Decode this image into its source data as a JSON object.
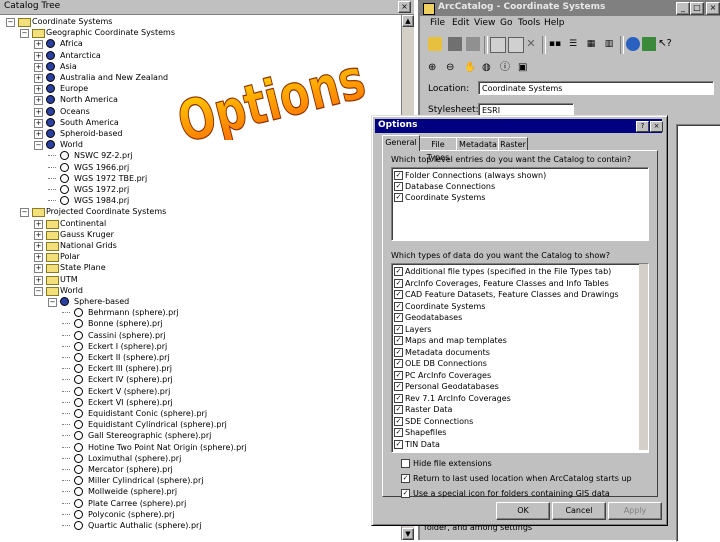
{
  "tree": {
    "title": "Catalog Tree",
    "close": "×",
    "rows": [
      {
        "label": "Coordinate Systems",
        "indent": 0,
        "exp": "−",
        "icon": "folder"
      },
      {
        "label": "Geographic Coordinate Systems",
        "indent": 1,
        "exp": "−",
        "icon": "folder"
      },
      {
        "label": "Africa",
        "indent": 2,
        "exp": "+",
        "icon": "globe"
      },
      {
        "label": "Antarctica",
        "indent": 2,
        "exp": "+",
        "icon": "globe"
      },
      {
        "label": "Asia",
        "indent": 2,
        "exp": "+",
        "icon": "globe"
      },
      {
        "label": "Australia and New Zealand",
        "indent": 2,
        "exp": "+",
        "icon": "globe"
      },
      {
        "label": "Europe",
        "indent": 2,
        "exp": "+",
        "icon": "globe"
      },
      {
        "label": "North America",
        "indent": 2,
        "exp": "+",
        "icon": "globe"
      },
      {
        "label": "Oceans",
        "indent": 2,
        "exp": "+",
        "icon": "globe"
      },
      {
        "label": "South America",
        "indent": 2,
        "exp": "+",
        "icon": "globe"
      },
      {
        "label": "Spheroid-based",
        "indent": 2,
        "exp": "+",
        "icon": "globe"
      },
      {
        "label": "World",
        "indent": 2,
        "exp": "−",
        "icon": "globe"
      },
      {
        "label": "NSWC 9Z-2.prj",
        "indent": 3,
        "exp": "",
        "icon": "prj"
      },
      {
        "label": "WGS 1966.prj",
        "indent": 3,
        "exp": "",
        "icon": "prj"
      },
      {
        "label": "WGS 1972 TBE.prj",
        "indent": 3,
        "exp": "",
        "icon": "prj"
      },
      {
        "label": "WGS 1972.prj",
        "indent": 3,
        "exp": "",
        "icon": "prj"
      },
      {
        "label": "WGS 1984.prj",
        "indent": 3,
        "exp": "",
        "icon": "prj"
      },
      {
        "label": "Projected Coordinate Systems",
        "indent": 1,
        "exp": "−",
        "icon": "folder"
      },
      {
        "label": "Continental",
        "indent": 2,
        "exp": "+",
        "icon": "folder"
      },
      {
        "label": "Gauss Kruger",
        "indent": 2,
        "exp": "+",
        "icon": "folder"
      },
      {
        "label": "National Grids",
        "indent": 2,
        "exp": "+",
        "icon": "folder"
      },
      {
        "label": "Polar",
        "indent": 2,
        "exp": "+",
        "icon": "folder"
      },
      {
        "label": "State Plane",
        "indent": 2,
        "exp": "+",
        "icon": "folder"
      },
      {
        "label": "UTM",
        "indent": 2,
        "exp": "+",
        "icon": "folder"
      },
      {
        "label": "World",
        "indent": 2,
        "exp": "−",
        "icon": "folder"
      },
      {
        "label": "Sphere-based",
        "indent": 3,
        "exp": "−",
        "icon": "globe"
      },
      {
        "label": "Behrmann (sphere).prj",
        "indent": 4,
        "exp": "",
        "icon": "prj"
      },
      {
        "label": "Bonne (sphere).prj",
        "indent": 4,
        "exp": "",
        "icon": "prj"
      },
      {
        "label": "Cassini (sphere).prj",
        "indent": 4,
        "exp": "",
        "icon": "prj"
      },
      {
        "label": "Eckert I (sphere).prj",
        "indent": 4,
        "exp": "",
        "icon": "prj"
      },
      {
        "label": "Eckert II (sphere).prj",
        "indent": 4,
        "exp": "",
        "icon": "prj"
      },
      {
        "label": "Eckert III (sphere).prj",
        "indent": 4,
        "exp": "",
        "icon": "prj"
      },
      {
        "label": "Eckert IV (sphere).prj",
        "indent": 4,
        "exp": "",
        "icon": "prj"
      },
      {
        "label": "Eckert V (sphere).prj",
        "indent": 4,
        "exp": "",
        "icon": "prj"
      },
      {
        "label": "Eckert VI (sphere).prj",
        "indent": 4,
        "exp": "",
        "icon": "prj"
      },
      {
        "label": "Equidistant Conic (sphere).prj",
        "indent": 4,
        "exp": "",
        "icon": "prj"
      },
      {
        "label": "Equidistant Cylindrical (sphere).prj",
        "indent": 4,
        "exp": "",
        "icon": "prj"
      },
      {
        "label": "Gall Stereographic (sphere).prj",
        "indent": 4,
        "exp": "",
        "icon": "prj"
      },
      {
        "label": "Hotine Two Point Nat Origin (sphere).prj",
        "indent": 4,
        "exp": "",
        "icon": "prj"
      },
      {
        "label": "Loximuthal (sphere).prj",
        "indent": 4,
        "exp": "",
        "icon": "prj"
      },
      {
        "label": "Mercator (sphere).prj",
        "indent": 4,
        "exp": "",
        "icon": "prj"
      },
      {
        "label": "Miller Cylindrical (sphere).prj",
        "indent": 4,
        "exp": "",
        "icon": "prj"
      },
      {
        "label": "Mollweide (sphere).prj",
        "indent": 4,
        "exp": "",
        "icon": "prj"
      },
      {
        "label": "Plate Carree (sphere).prj",
        "indent": 4,
        "exp": "",
        "icon": "prj"
      },
      {
        "label": "Polyconic (sphere).prj",
        "indent": 4,
        "exp": "",
        "icon": "prj"
      },
      {
        "label": "Quartic Authalic (sphere).prj",
        "indent": 4,
        "exp": "",
        "icon": "prj"
      }
    ]
  },
  "arc": {
    "title": "ArcCatalog - Coordinate Systems",
    "win_buttons": [
      "_",
      "□",
      "×"
    ],
    "menu": [
      "File",
      "Edit",
      "View",
      "Go",
      "Tools",
      "Help"
    ],
    "location_label": "Location:",
    "location_value": "Coordinate Systems",
    "stylesheet_label": "Stylesheet:",
    "stylesheet_value": "ESRI",
    "status": "folder, and among settings"
  },
  "options": {
    "title": "Options",
    "title_buttons": [
      "?",
      "×"
    ],
    "tabs": [
      "General",
      "File Types",
      "Metadata",
      "Raster"
    ],
    "q1": "Which top level entries do you want the Catalog to contain?",
    "top_entries": [
      "Folder Connections (always shown)",
      "Database Connections",
      "Coordinate Systems"
    ],
    "q2": "Which types of data do you want the Catalog to show?",
    "data_types": [
      "Additional file types (specified in the File Types tab)",
      "ArcInfo Coverages, Feature Classes and Info Tables",
      "CAD Feature Datasets, Feature Classes and Drawings",
      "Coordinate Systems",
      "Geodatabases",
      "Layers",
      "Maps and map templates",
      "Metadata documents",
      "OLE DB Connections",
      "PC ArcInfo Coverages",
      "Personal Geodatabases",
      "Rev 7.1 ArcInfo Coverages",
      "Raster Data",
      "SDE Connections",
      "Shapefiles",
      "TIN Data"
    ],
    "hide_ext": "Hide file extensions",
    "return_last": "Return to last used location when ArcCatalog starts up",
    "special_icon": "Use a special icon for folders containing GIS data",
    "buttons": [
      "OK",
      "Cancel",
      "Apply"
    ]
  },
  "wordart": {
    "text": "Options",
    "color_top": "#ffd400",
    "color_bottom": "#ff6a00"
  }
}
